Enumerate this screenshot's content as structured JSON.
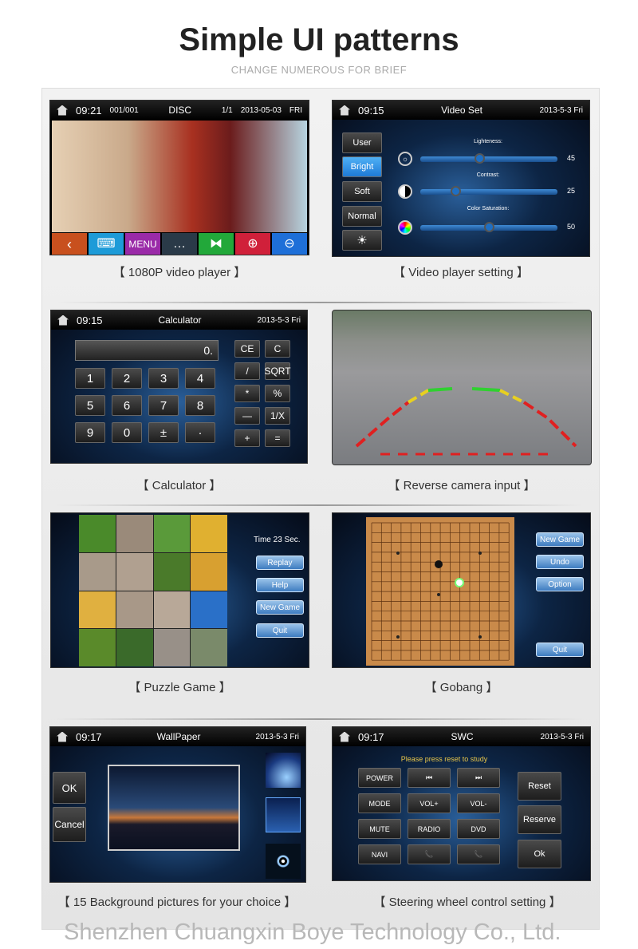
{
  "header": {
    "title": "Simple UI patterns",
    "subtitle": "CHANGE NUMEROUS FOR BRIEF"
  },
  "panels": {
    "video_player": {
      "time": "09:21",
      "track": "001/001",
      "source": "DISC",
      "page": "1/1",
      "date": "2013-05-03",
      "day": "FRI",
      "menu_label": "MENU",
      "caption": "【 1080P video player 】"
    },
    "video_set": {
      "time": "09:15",
      "title": "Video Set",
      "date": "2013-5-3 Fri",
      "modes": [
        "User",
        "Bright",
        "Soft",
        "Normal"
      ],
      "selected_mode": "Bright",
      "sliders": [
        {
          "label": "Lighteness:",
          "value": "45"
        },
        {
          "label": "Contrast:",
          "value": "25"
        },
        {
          "label": "Color Saturation:",
          "value": "50"
        }
      ],
      "caption": "【 Video player setting 】"
    },
    "calculator": {
      "time": "09:15",
      "title": "Calculator",
      "date": "2013-5-3 Fri",
      "display": "0.",
      "keys": [
        "1",
        "2",
        "3",
        "4",
        "5",
        "6",
        "7",
        "8",
        "9",
        "0",
        "±",
        "·"
      ],
      "ops": [
        "CE",
        "C",
        "/",
        "SQRT",
        "*",
        "%",
        "—",
        "1/X",
        "+",
        "="
      ],
      "caption": "【 Calculator 】"
    },
    "reverse_camera": {
      "caption": "【 Reverse camera input 】"
    },
    "puzzle": {
      "timer": "Time 23 Sec.",
      "buttons": [
        "Replay",
        "Help",
        "New Game",
        "Quit"
      ],
      "caption": "【 Puzzle Game 】"
    },
    "gobang": {
      "buttons": [
        "New Game",
        "Undo",
        "Option",
        "Quit"
      ],
      "caption": "【 Gobang 】"
    },
    "wallpaper": {
      "time": "09:17",
      "title": "WallPaper",
      "date": "2013-5-3 Fri",
      "ok": "OK",
      "cancel": "Cancel",
      "caption": "【 15 Background pictures for your choice 】"
    },
    "swc": {
      "time": "09:17",
      "title": "SWC",
      "date": "2013-5-3 Fri",
      "prompt": "Please press reset to study",
      "keys": [
        "POWER",
        "⏮",
        "⏭",
        "MODE",
        "VOL+",
        "VOL-",
        "MUTE",
        "RADIO",
        "DVD",
        "NAVI",
        "📞",
        "📞"
      ],
      "side": [
        "Reset",
        "Reserve",
        "Ok"
      ],
      "caption": "【 Steering wheel control setting 】"
    }
  },
  "footer": "Shenzhen Chuangxin Boye Technology Co., Ltd.",
  "colors": {
    "accent_blue": "#1e8ae6",
    "prompt_yellow": "#e8c64a",
    "toolbar": [
      "#c8501e",
      "#1d9bd8",
      "#9a2aa8",
      "#2a3a48",
      "#22a83a",
      "#d0203a",
      "#1e6fd8"
    ]
  }
}
